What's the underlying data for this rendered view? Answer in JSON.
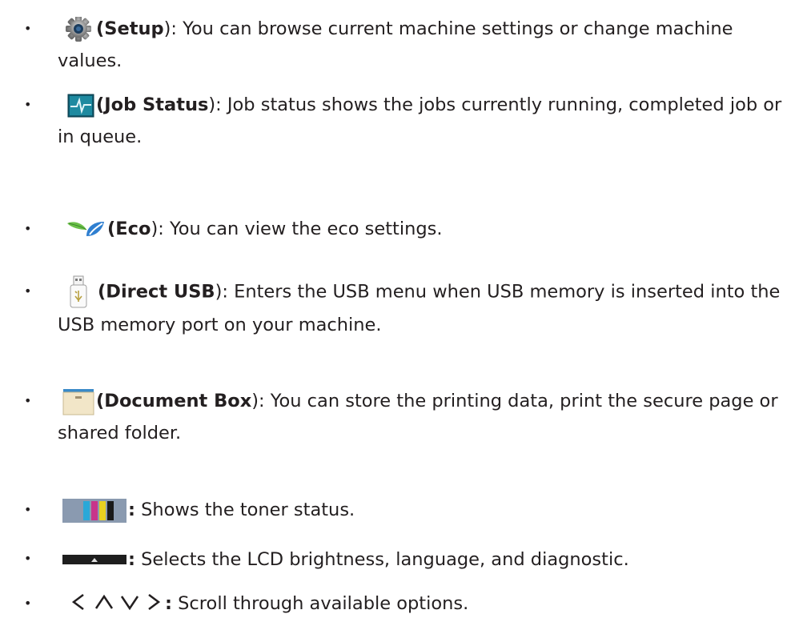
{
  "items": [
    {
      "icon": "setup-gear-icon",
      "bold": "(Setup",
      "close": "):",
      "desc": " You can browse current machine settings or change machine values."
    },
    {
      "icon": "job-status-icon",
      "bold": "(Job Status",
      "close": "):",
      "desc": " Job status shows the jobs currently running, completed job or in queue."
    },
    {
      "icon": "eco-leaf-icon",
      "bold": "(Eco",
      "close": "):",
      "desc": " You can view the eco settings."
    },
    {
      "icon": "usb-drive-icon",
      "bold": "(Direct USB",
      "close": "):",
      "desc": " Enters the USB menu when USB memory is inserted into the USB memory port on your machine."
    },
    {
      "icon": "document-box-icon",
      "bold": "(Document Box",
      "close": "):",
      "desc": " You can store the printing data, print the secure page or shared folder."
    },
    {
      "icon": "toner-status-icon",
      "bold": "",
      "close": ":",
      "desc": " Shows the toner status."
    },
    {
      "icon": "lcd-menu-icon",
      "bold": "",
      "close": ":",
      "desc": " Selects the LCD brightness, language, and diagnostic."
    },
    {
      "icon": "scroll-arrows",
      "arrows": "< ∧ ∨ >",
      "bold": "",
      "close": ":",
      "desc": " Scroll through available options."
    }
  ],
  "bullet": "•"
}
